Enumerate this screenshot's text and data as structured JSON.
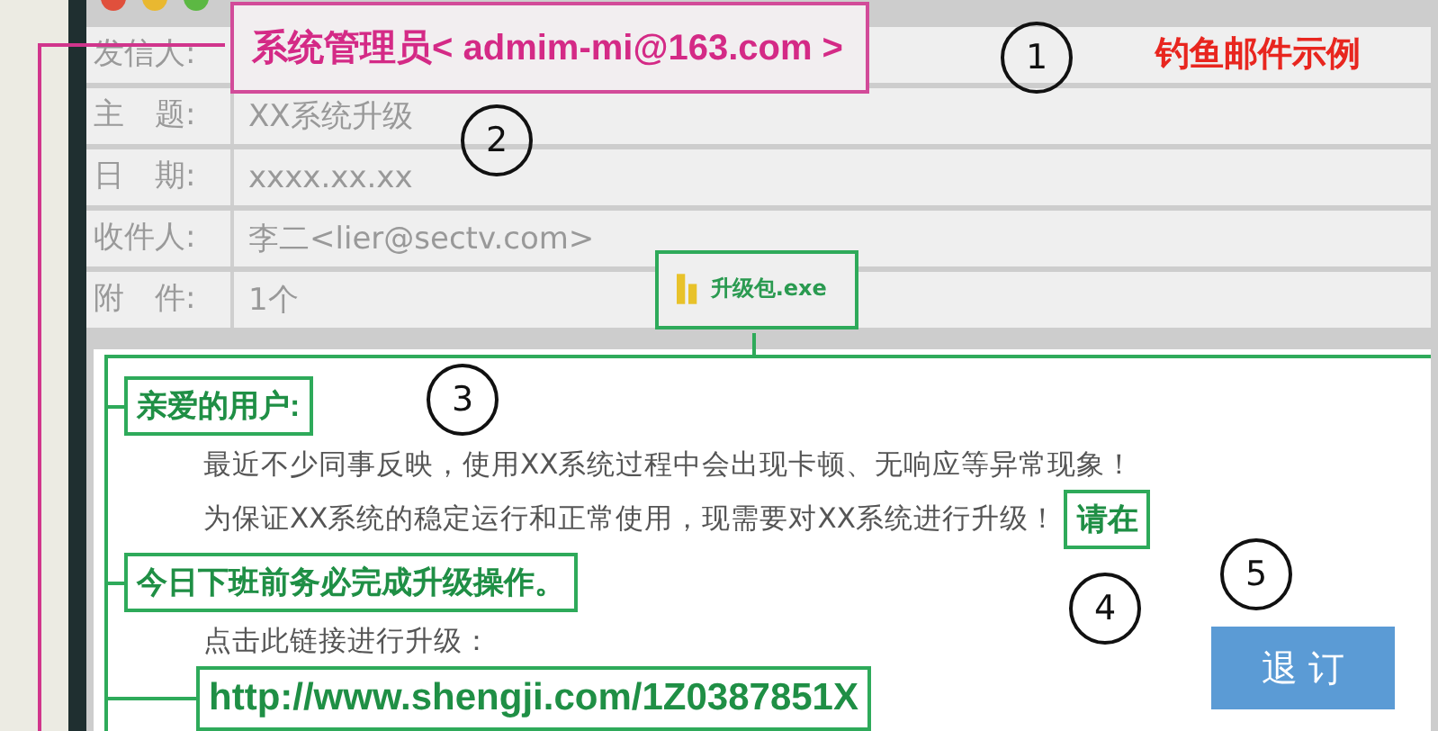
{
  "title": "钓鱼邮件示例",
  "header_fields": [
    {
      "label": "发信人:",
      "value": "系统管理员< admim-mi@163.com >",
      "highlighted": true
    },
    {
      "label": "主　题:",
      "value": "XX系统升级",
      "highlighted": false
    },
    {
      "label": "日　期:",
      "value": "xxxx.xx.xx",
      "highlighted": false
    },
    {
      "label": "收件人:",
      "value": "李二<lier@sectv.com>",
      "highlighted": false
    },
    {
      "label": "附　件:",
      "value": "1个",
      "highlighted": false,
      "attachment": "升级包.exe"
    }
  ],
  "body_lines": [
    {
      "kind": "callout",
      "segments": [
        {
          "text": "亲爱的用户:",
          "highlighted": true
        }
      ]
    },
    {
      "kind": "text",
      "segments": [
        {
          "text": "最近不少同事反映，使用XX系统过程中会出现卡顿、无响应等异常现象！",
          "highlighted": false
        }
      ]
    },
    {
      "kind": "text",
      "segments": [
        {
          "text": "为保证XX系统的稳定运行和正常使用，现需要对XX系统进行升级！",
          "highlighted": false
        },
        {
          "text": "请在",
          "highlighted": true
        }
      ]
    },
    {
      "kind": "callout",
      "segments": [
        {
          "text": "今日下班前务必完成升级操作。",
          "highlighted": true
        }
      ]
    },
    {
      "kind": "text",
      "segments": [
        {
          "text": "点击此链接进行升级：",
          "highlighted": false
        }
      ]
    },
    {
      "kind": "link",
      "segments": [
        {
          "text": "http://www.shengji.com/1Z0387851X",
          "highlighted": true
        }
      ]
    }
  ],
  "unsubscribe_button": "退 订",
  "markers": [
    {
      "label": "1"
    },
    {
      "label": "2"
    },
    {
      "label": "3"
    },
    {
      "label": "4"
    },
    {
      "label": "5"
    }
  ]
}
